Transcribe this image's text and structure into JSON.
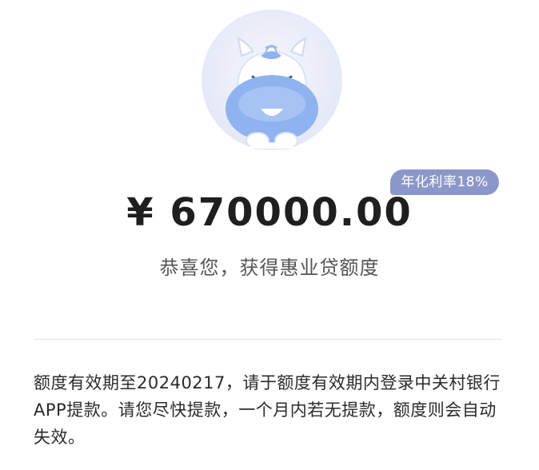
{
  "offer": {
    "rate_badge": "年化利率18%",
    "amount": "¥ 670000.00",
    "congrats": "恭喜您，获得惠业贷额度"
  },
  "notice": {
    "text": "额度有效期至20240217，请于额度有效期内登录中关村银行APP提款。请您尽快提款，一个月内若无提款，额度则会自动失效。"
  },
  "colors": {
    "badge": "#8c97c9",
    "mascot_body": "#8eb3f0",
    "mascot_bg": "#e9ecf8"
  },
  "icons": {
    "mascot": "unicorn-mascot-icon"
  }
}
